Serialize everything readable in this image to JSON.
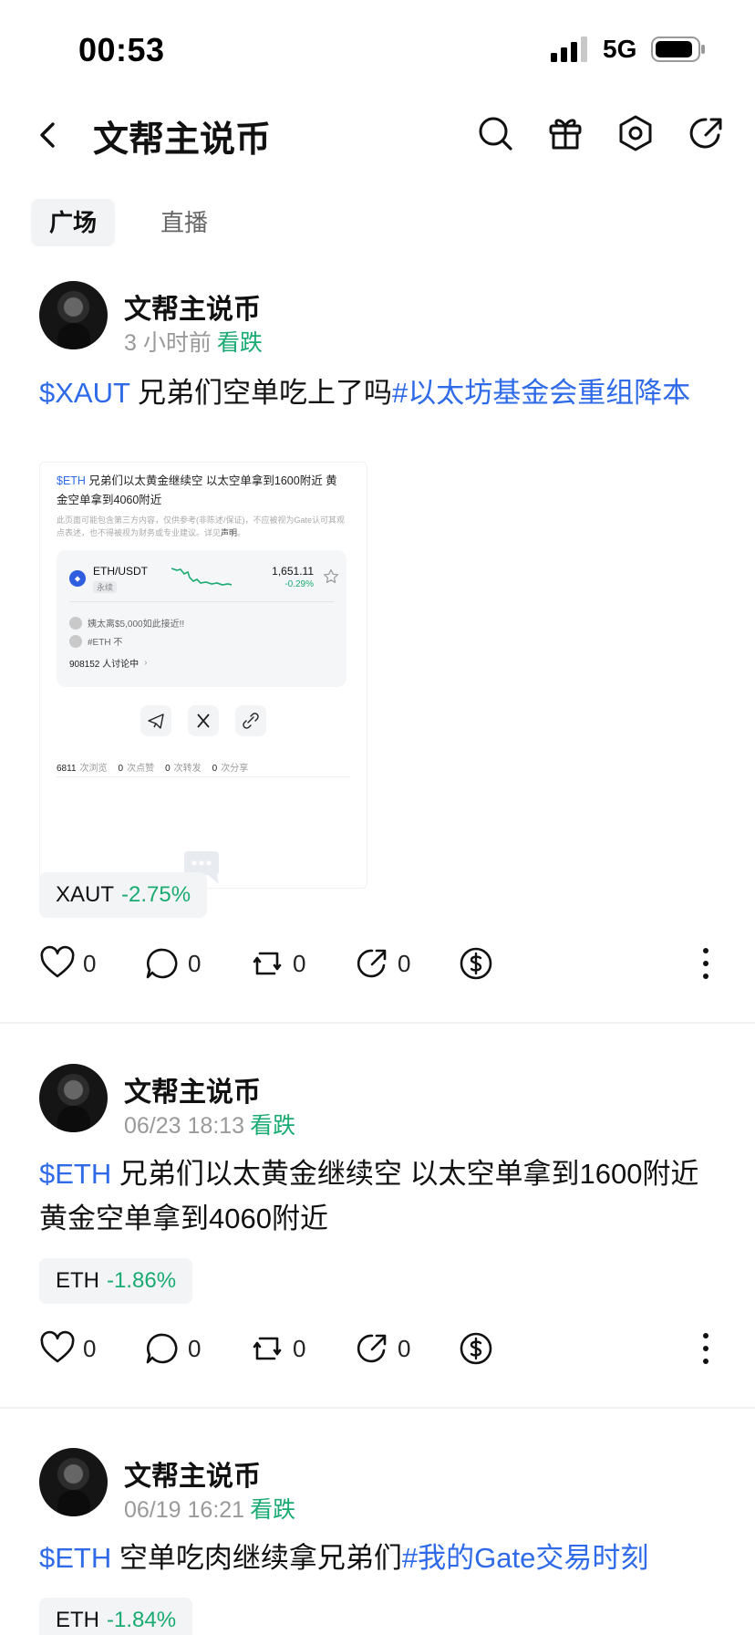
{
  "status": {
    "time": "00:53",
    "network": "5G"
  },
  "header": {
    "title": "文帮主说币"
  },
  "tabs": [
    {
      "label": "广场"
    },
    {
      "label": "直播"
    }
  ],
  "posts": [
    {
      "author": "文帮主说币",
      "time": "3 小时前",
      "sentiment": "看跌",
      "text_tag": "$XAUT",
      "text_body": " 兄弟们空单吃上了吗",
      "text_topic": "#以太坊基金会重组降本",
      "ticker": {
        "symbol": "XAUT",
        "change": "-2.75%"
      },
      "counts": {
        "likes": "0",
        "comments": "0",
        "reposts": "0",
        "shares": "0"
      },
      "embed": {
        "title_tag": "$ETH",
        "title_body": " 兄弟们以太黄金继续空 以太空单拿到1600附近 黄金空单拿到4060附近",
        "disclaimer": "此页面可能包含第三方内容，仅供参考(非陈述/保证)，不应被视为Gate认可其观点表述，也不得被视为财务或专业建议。详见",
        "disclaimer_link": "声明",
        "pair": "ETH/USDT",
        "pair_type": "永续",
        "price": "1,651.11",
        "price_change": "-0.29%",
        "comment1": "姨太离$5,000如此接近!!",
        "comment2": "#ETH 不",
        "discussing": "908152 人讨论中",
        "stats": [
          {
            "n": "6811",
            "label": "次浏览"
          },
          {
            "n": "0",
            "label": "次点赞"
          },
          {
            "n": "0",
            "label": "次转发"
          },
          {
            "n": "0",
            "label": "次分享"
          }
        ]
      }
    },
    {
      "author": "文帮主说币",
      "time": "06/23 18:13",
      "sentiment": "看跌",
      "text_tag": "$ETH",
      "text_body": " 兄弟们以太黄金继续空 以太空单拿到1600附近 黄金空单拿到4060附近",
      "ticker": {
        "symbol": "ETH",
        "change": "-1.86%"
      },
      "counts": {
        "likes": "0",
        "comments": "0",
        "reposts": "0",
        "shares": "0"
      }
    },
    {
      "author": "文帮主说币",
      "time": "06/19 16:21",
      "sentiment": "看跌",
      "text_tag": "$ETH",
      "text_body": " 空单吃肉继续拿兄弟们",
      "text_topic": "#我的Gate交易时刻",
      "ticker": {
        "symbol": "ETH",
        "change": "-1.84%"
      }
    }
  ],
  "colors": {
    "accent": "#2f6ae8",
    "down_green": "#1aab72"
  }
}
